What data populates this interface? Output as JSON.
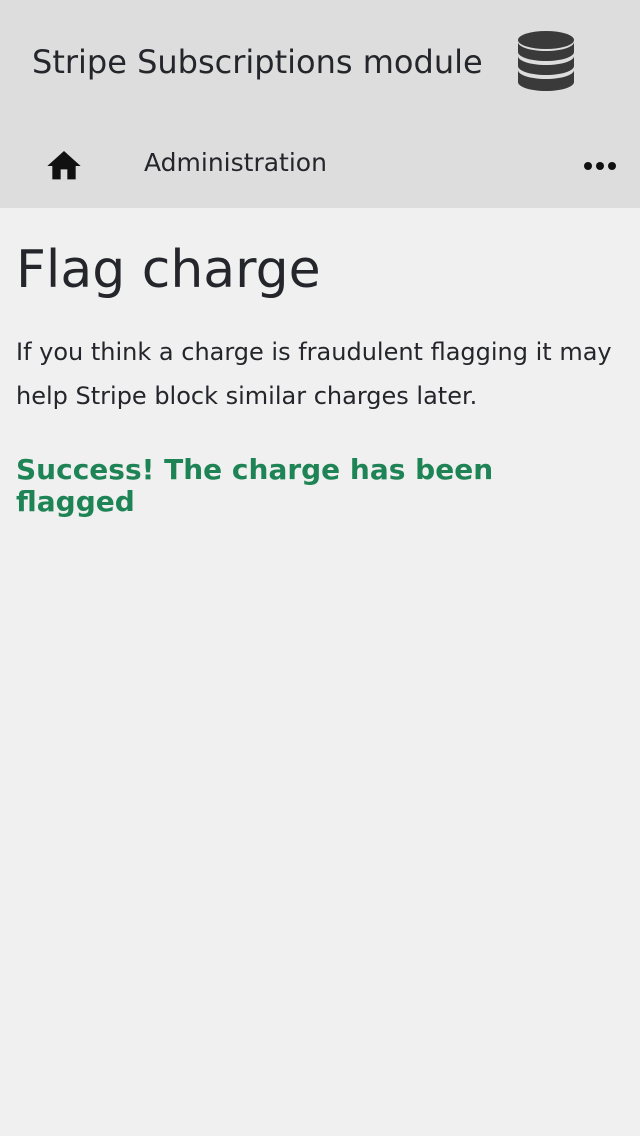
{
  "header": {
    "title": "Stripe Subscriptions module",
    "logo_icon": "database-icon"
  },
  "nav": {
    "home_icon": "home-icon",
    "admin_label": "Administration",
    "more_icon": "more-horizontal-icon"
  },
  "main": {
    "title": "Flag charge",
    "description": "If you think a charge is fraudulent flagging it may help Stripe block similar charges later.",
    "success_message": "Success! The charge has been flagged"
  },
  "colors": {
    "header_bg": "#dddddd",
    "page_bg": "#f0f0f0",
    "text": "#25262b",
    "success": "#1e8456",
    "icon": "#3a3a3a"
  }
}
